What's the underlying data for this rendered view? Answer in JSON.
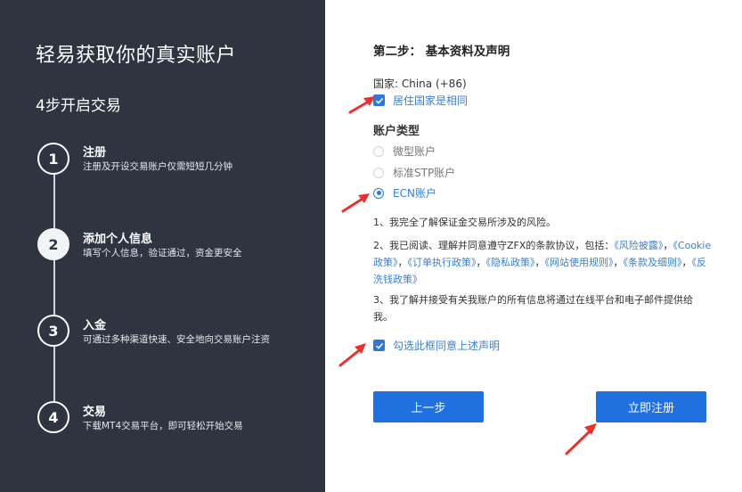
{
  "left": {
    "title": "轻易获取你的真实账户",
    "subtitle": "4步开启交易",
    "steps": [
      {
        "number": "1",
        "title": "注册",
        "desc": "注册及开设交易账户仅需短短几分钟"
      },
      {
        "number": "2",
        "title": "添加个人信息",
        "desc": "填写个人信息，验证通过，资金更安全"
      },
      {
        "number": "3",
        "title": "入金",
        "desc": "可通过多种渠道快速、安全地向交易账户注资"
      },
      {
        "number": "4",
        "title": "交易",
        "desc": "下载MT4交易平台，即可轻松开始交易"
      }
    ]
  },
  "form": {
    "heading": "第二步： 基本资料及声明",
    "country": "国家: China (+86)",
    "same_residence": "居住国家是相同",
    "account_type_label": "账户类型",
    "account_types": [
      {
        "label": "微型账户",
        "checked": false
      },
      {
        "label": "标准STP账户",
        "checked": false
      },
      {
        "label": "ECN账户",
        "checked": true
      }
    ],
    "declaration": {
      "item1": "1、我完全了解保证金交易所涉及的风险。",
      "item2_prefix": "2、我已阅读、理解并同意遵守ZFX的条款协议，包括：",
      "links": [
        "《风险披露》",
        "《Cookie政策》",
        "《订单执行政策》",
        "《隐私政策》",
        "《网站使用规则》",
        "《条款及细则》",
        "《反洗钱政策》"
      ],
      "sep": "，",
      "item3": "3、我了解并接受有关我账户的所有信息将通过在线平台和电子邮件提供给我。"
    },
    "agree_label": "勾选此框同意上述声明",
    "prev_button": "上一步",
    "submit_button": "立即注册"
  },
  "colors": {
    "panel": "#2e3440",
    "accent": "#2170e0",
    "link": "#3a7fd5",
    "arrow": "#e8322d"
  }
}
